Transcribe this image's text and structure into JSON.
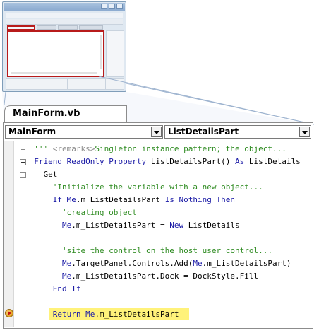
{
  "tab": {
    "title": "MainForm.vb"
  },
  "class_combo": {
    "value": "MainForm"
  },
  "member_combo": {
    "value": "ListDetailsPart"
  },
  "code_lines": [
    {
      "indent": 2,
      "parts": [
        {
          "t": "''' ",
          "c": "cm"
        },
        {
          "t": "<remarks>",
          "c": "xm"
        },
        {
          "t": "Singleton instance pattern; the object...",
          "c": "cm"
        }
      ]
    },
    {
      "indent": 2,
      "parts": [
        {
          "t": "Friend ReadOnly Property ",
          "c": "kw"
        },
        {
          "t": "ListDetailsPart() ",
          "c": ""
        },
        {
          "t": "As ",
          "c": "kw"
        },
        {
          "t": "ListDetails",
          "c": ""
        }
      ]
    },
    {
      "indent": 4,
      "parts": [
        {
          "t": "Get",
          "c": ""
        }
      ]
    },
    {
      "indent": 6,
      "parts": [
        {
          "t": "'Initialize the variable with a new object...",
          "c": "cm"
        }
      ]
    },
    {
      "indent": 6,
      "parts": [
        {
          "t": "If ",
          "c": "kw"
        },
        {
          "t": "Me",
          "c": "kw"
        },
        {
          "t": ".m_ListDetailsPart ",
          "c": ""
        },
        {
          "t": "Is Nothing Then",
          "c": "kw"
        }
      ]
    },
    {
      "indent": 8,
      "parts": [
        {
          "t": "'creating object",
          "c": "cm"
        }
      ]
    },
    {
      "indent": 8,
      "parts": [
        {
          "t": "Me",
          "c": "kw"
        },
        {
          "t": ".m_ListDetailsPart = ",
          "c": ""
        },
        {
          "t": "New ",
          "c": "kw"
        },
        {
          "t": "ListDetails",
          "c": ""
        }
      ]
    },
    {
      "indent": 0,
      "parts": []
    },
    {
      "indent": 8,
      "parts": [
        {
          "t": "'site the control on the host user control...",
          "c": "cm"
        }
      ]
    },
    {
      "indent": 8,
      "parts": [
        {
          "t": "Me",
          "c": "kw"
        },
        {
          "t": ".TargetPanel.Controls.Add(",
          "c": ""
        },
        {
          "t": "Me",
          "c": "kw"
        },
        {
          "t": ".m_ListDetailsPart)",
          "c": ""
        }
      ]
    },
    {
      "indent": 8,
      "parts": [
        {
          "t": "Me",
          "c": "kw"
        },
        {
          "t": ".m_ListDetailsPart.Dock = DockStyle.Fill",
          "c": ""
        }
      ]
    },
    {
      "indent": 6,
      "parts": [
        {
          "t": "End If",
          "c": "kw"
        }
      ]
    },
    {
      "indent": 0,
      "parts": []
    },
    {
      "indent": 6,
      "highlight": true,
      "parts": [
        {
          "t": "Return ",
          "c": "kw"
        },
        {
          "t": "Me",
          "c": "kw"
        },
        {
          "t": ".m_ListDetailsPart",
          "c": ""
        }
      ]
    }
  ],
  "colors": {
    "keyword": "#1a1aa6",
    "comment": "#2e8b21",
    "xml_tag": "#8f8f8f",
    "current_statement": "#fff27a",
    "thumbnail_highlight": "#b81b1b"
  },
  "icons": {
    "execution_pointer": "current-statement-arrow-icon",
    "collapse": "outline-collapse-icon",
    "dropdown": "dropdown-arrow-icon"
  }
}
